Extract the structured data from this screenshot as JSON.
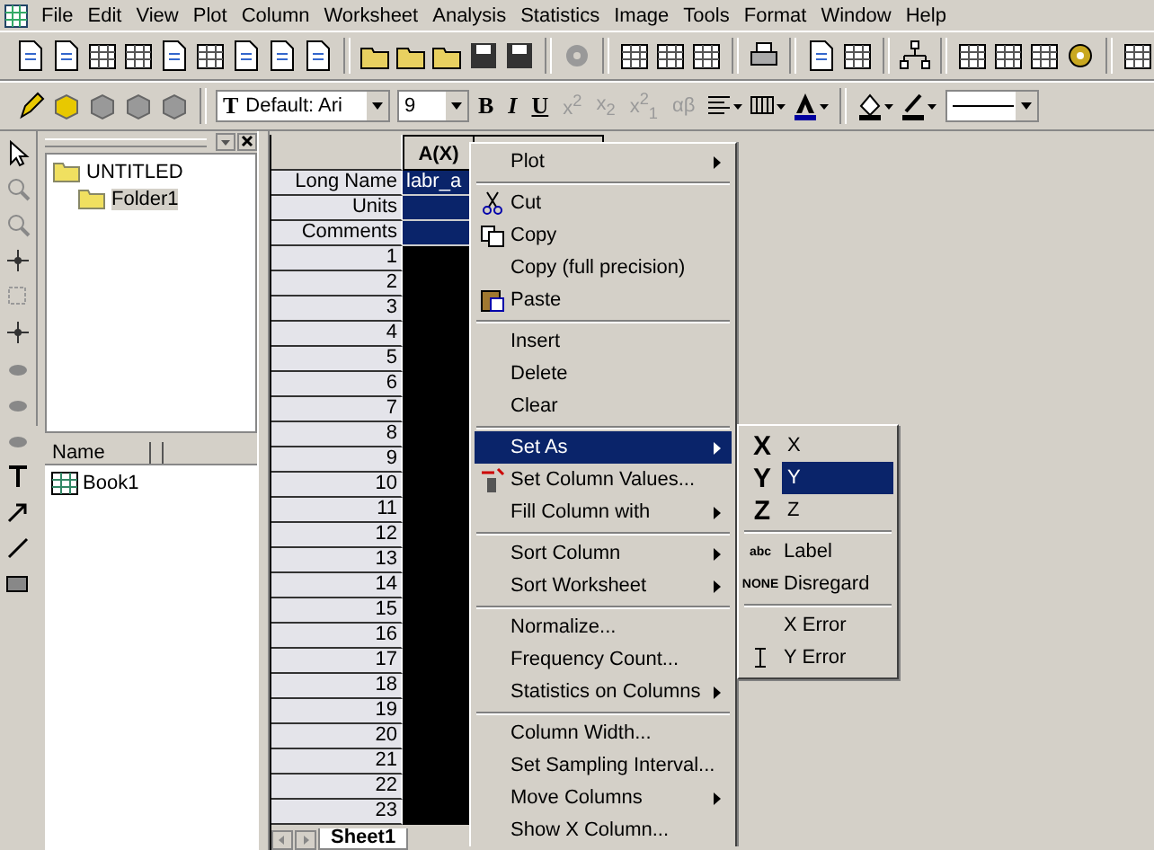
{
  "menubar": [
    {
      "label": "File"
    },
    {
      "label": "Edit"
    },
    {
      "label": "View"
    },
    {
      "label": "Plot"
    },
    {
      "label": "Column"
    },
    {
      "label": "Worksheet"
    },
    {
      "label": "Analysis"
    },
    {
      "label": "Statistics"
    },
    {
      "label": "Image"
    },
    {
      "label": "Tools"
    },
    {
      "label": "Format"
    },
    {
      "label": "Window"
    },
    {
      "label": "Help"
    }
  ],
  "format_toolbar": {
    "font_glyph": "T",
    "font": "Default: Ari",
    "size": "9",
    "buttons": [
      {
        "label": "B",
        "disabled": false
      },
      {
        "label": "I",
        "disabled": false
      },
      {
        "label": "U",
        "disabled": false
      },
      {
        "label": "x$^{2}$",
        "disabled": true
      },
      {
        "label": "x$_{2}$",
        "disabled": true
      },
      {
        "label": "x$^{2}$$_{1}$",
        "disabled": true
      },
      {
        "label": "αβ",
        "disabled": true
      }
    ]
  },
  "explorer": {
    "folders": [
      {
        "label": "UNTITLED",
        "selected": false,
        "children": [
          {
            "label": "Folder1",
            "selected": true
          }
        ]
      }
    ],
    "list_header": "Name",
    "items": [
      {
        "label": "Book1"
      }
    ]
  },
  "worksheet": {
    "columns": [
      {
        "label": "A(X)",
        "selected": true
      }
    ],
    "label_rows": [
      {
        "label": "Long Name",
        "value": "labr_a"
      },
      {
        "label": "Units"
      },
      {
        "label": "Comments"
      }
    ],
    "rows": [
      "1",
      "2",
      "3",
      "4",
      "5",
      "6",
      "7",
      "8",
      "9",
      "10",
      "11",
      "12",
      "13",
      "14",
      "15",
      "16",
      "17",
      "18",
      "19",
      "20",
      "21",
      "22",
      "23"
    ],
    "sheet_tab": "Sheet1"
  },
  "context_menu": [
    {
      "kind": "item",
      "label": "Plot",
      "submenu": true,
      "selected": false
    },
    {
      "kind": "separator"
    },
    {
      "kind": "item",
      "label": "Cut",
      "submenu": false,
      "selected": false
    },
    {
      "kind": "item",
      "label": "Copy",
      "submenu": false,
      "selected": false
    },
    {
      "kind": "item",
      "label": "Copy (full precision)",
      "submenu": false,
      "selected": false
    },
    {
      "kind": "item",
      "label": "Paste",
      "submenu": false,
      "selected": false
    },
    {
      "kind": "separator"
    },
    {
      "kind": "item",
      "label": "Insert",
      "submenu": false,
      "selected": false
    },
    {
      "kind": "item",
      "label": "Delete",
      "submenu": false,
      "selected": false
    },
    {
      "kind": "item",
      "label": "Clear",
      "submenu": false,
      "selected": false
    },
    {
      "kind": "separator"
    },
    {
      "kind": "item",
      "label": "Set As",
      "submenu": true,
      "selected": true
    },
    {
      "kind": "item",
      "label": "Set Column Values...",
      "submenu": false,
      "selected": false
    },
    {
      "kind": "item",
      "label": "Fill Column with",
      "submenu": true,
      "selected": false
    },
    {
      "kind": "separator"
    },
    {
      "kind": "item",
      "label": "Sort Column",
      "submenu": true,
      "selected": false
    },
    {
      "kind": "item",
      "label": "Sort Worksheet",
      "submenu": true,
      "selected": false
    },
    {
      "kind": "separator"
    },
    {
      "kind": "item",
      "label": "Normalize...",
      "submenu": false,
      "selected": false
    },
    {
      "kind": "item",
      "label": "Frequency Count...",
      "submenu": false,
      "selected": false
    },
    {
      "kind": "item",
      "label": "Statistics on Columns",
      "submenu": true,
      "selected": false
    },
    {
      "kind": "separator"
    },
    {
      "kind": "item",
      "label": "Column Width...",
      "submenu": false,
      "selected": false
    },
    {
      "kind": "item",
      "label": "Set Sampling Interval...",
      "submenu": false,
      "selected": false
    },
    {
      "kind": "item",
      "label": "Move Columns",
      "submenu": true,
      "selected": false
    },
    {
      "kind": "item",
      "label": "Show X Column...",
      "submenu": false,
      "selected": false
    }
  ],
  "set_as_submenu": [
    {
      "kind": "item",
      "glyph": "X",
      "label": "X",
      "selected": false
    },
    {
      "kind": "item",
      "glyph": "Y",
      "label": "Y",
      "selected": true
    },
    {
      "kind": "item",
      "glyph": "Z",
      "label": "Z",
      "selected": false
    },
    {
      "kind": "separator"
    },
    {
      "kind": "item",
      "glyph": "abc",
      "label": "Label",
      "selected": false
    },
    {
      "kind": "item",
      "glyph": "NONE",
      "label": "Disregard",
      "selected": false
    },
    {
      "kind": "separator"
    },
    {
      "kind": "item",
      "label": "X Error",
      "selected": false
    },
    {
      "kind": "item",
      "label": "Y Error",
      "selected": false
    }
  ]
}
